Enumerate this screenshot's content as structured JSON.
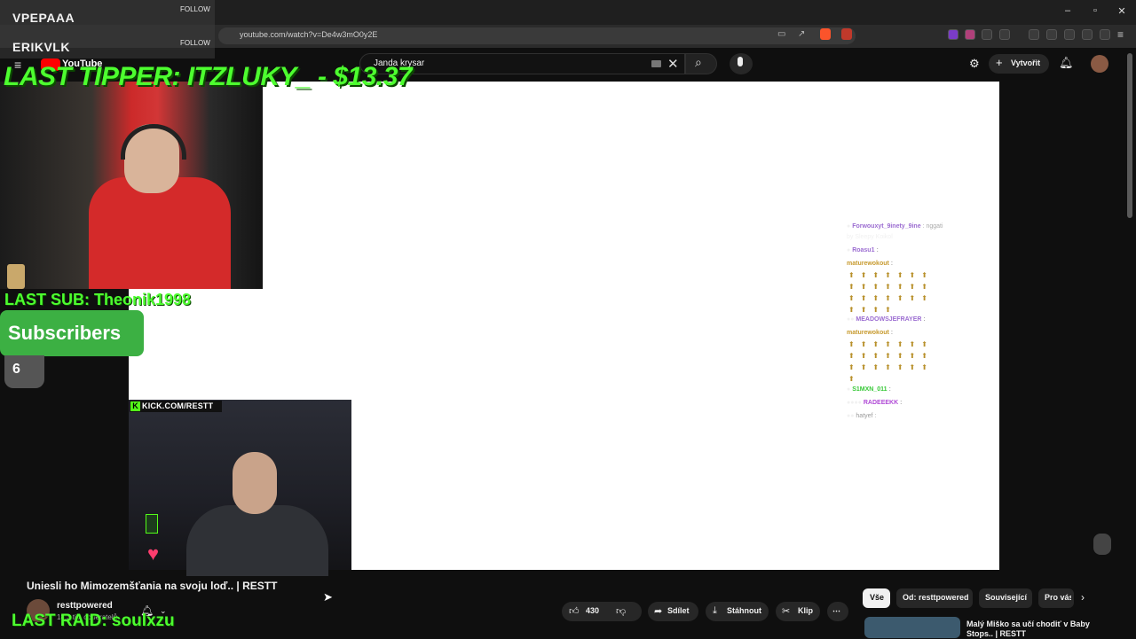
{
  "browser": {
    "url": "youtube.com/watch?v=De4w3mO0y2E"
  },
  "masthead": {
    "logo_text": "YouTube",
    "search_value": "Janda krysar",
    "create_label": "Vytvořit"
  },
  "overlay": {
    "follows": [
      {
        "name": "VPEPAAA",
        "label": "FOLLOW"
      },
      {
        "name": "ERIKVLK",
        "label": "FOLLOW"
      }
    ],
    "last_tipper": "LAST TIPPER: ITZLUKY_ - $13.37",
    "last_sub": "LAST SUB: Theonik1998",
    "subscribers_label": "Subscribers",
    "subscribers_count": "6",
    "kick_badge": "KICK.COM/RESTT",
    "last_raid": "LAST RAID: soulxzu"
  },
  "chat": [
    {
      "user": "Forwouxyt_9inety_9ine",
      "text": ": nggati",
      "color": "#9b6cd1"
    },
    {
      "user": "",
      "text": "by Sleepy Koikol",
      "color": "#888888"
    },
    {
      "user": "Roasu1",
      "text": ":",
      "color": "#9b6cd1"
    },
    {
      "user": "maturewokout",
      "text": ":",
      "color": "#c79a2e"
    },
    {
      "user": "MEADOWSJEFRAYER",
      "text": ":",
      "color": "#9b6cd1"
    },
    {
      "user": "maturewokout",
      "text": ":",
      "color": "#c79a2e"
    },
    {
      "user": "S1MXN_011",
      "text": ":",
      "color": "#37c837"
    },
    {
      "user": "RADEEEKK",
      "text": ":",
      "color": "#b04ad6"
    },
    {
      "user": "hatyef",
      "text": ":",
      "color": "#999999"
    }
  ],
  "video": {
    "title": "Uniesli ho Mimozemšťania na svoju loď.. | RESTT",
    "channel_name": "resttpowered",
    "channel_subs": "18,3 tis. odběratelů",
    "likes": "430",
    "share_label": "Sdílet",
    "download_label": "Stáhnout",
    "clip_label": "Klip",
    "more_label": "⋯"
  },
  "chips": [
    {
      "label": "Vše"
    },
    {
      "label": "Od: resttpowered"
    },
    {
      "label": "Související"
    },
    {
      "label": "Pro vás"
    }
  ],
  "recommendation": {
    "title": "Malý Miško sa učí chodiť v Baby Stops.. | RESTT"
  },
  "colors": {
    "overlay_green": "#4dff2f",
    "subscribers_bg": "#3cb043",
    "youtube_red": "#ff0000",
    "kick_green": "#53fc18"
  }
}
